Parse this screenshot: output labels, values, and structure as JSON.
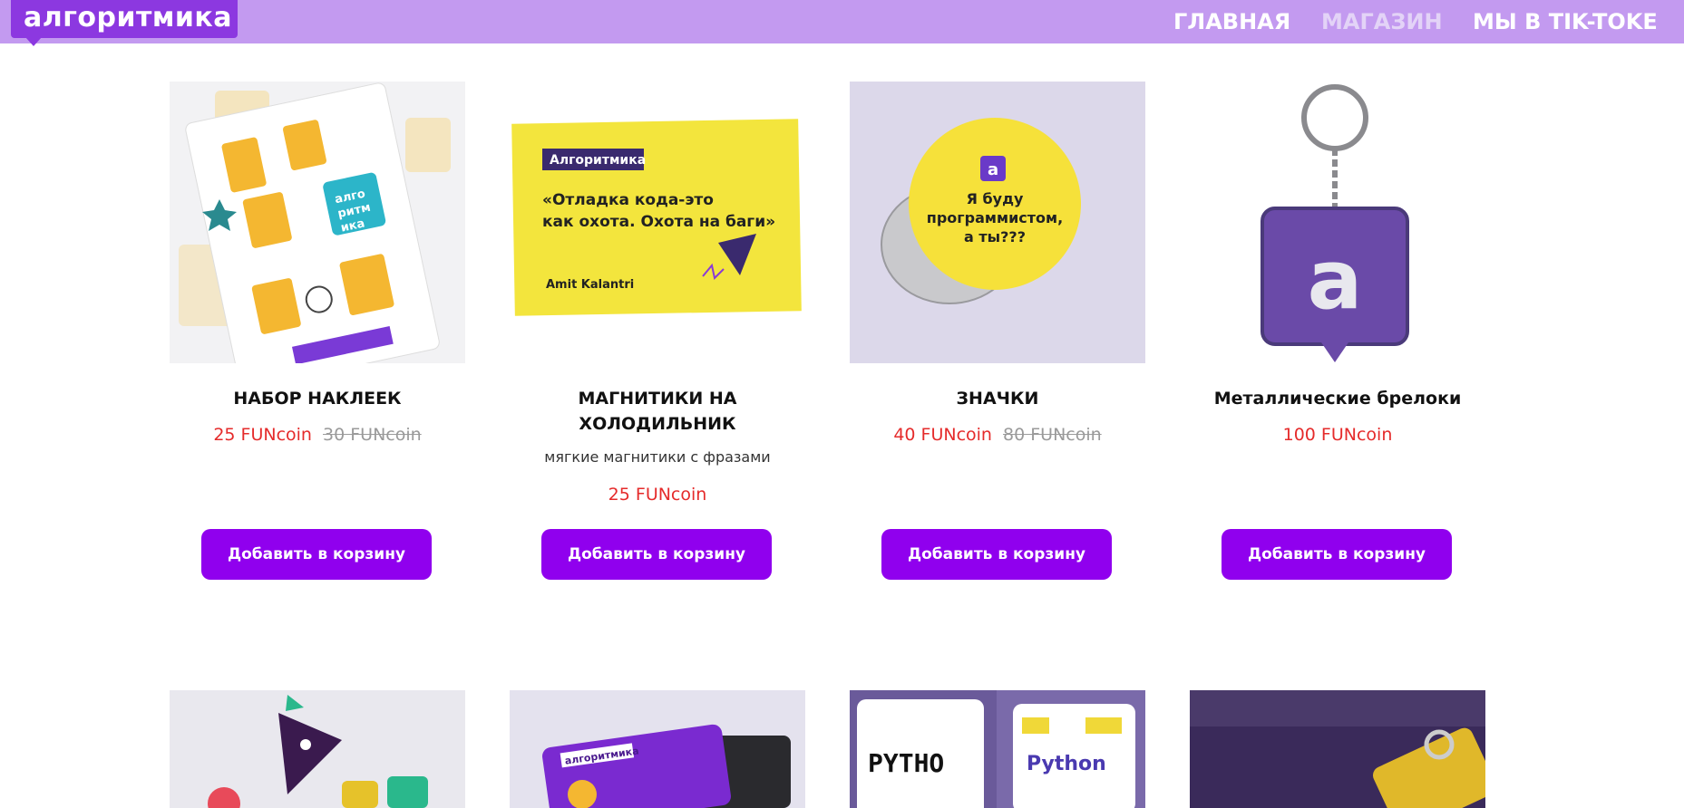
{
  "header": {
    "logo_text": "алгоритмика",
    "nav": [
      "ГЛАВНАЯ",
      "МАГАЗИН",
      "МЫ В TIK-TOKE"
    ]
  },
  "products": [
    {
      "title": "НАБОР НАКЛЕЕК",
      "price": "25 FUNcoin",
      "old_price": "30 FUNcoin",
      "button": "Добавить в корзину"
    },
    {
      "title_line1": "МАГНИТИКИ НА",
      "title_line2": "ХОЛОДИЛЬНИК",
      "description": "мягкие магнитики с фразами",
      "price": "25 FUNcoin",
      "button": "Добавить в корзину",
      "image_text": {
        "brand": "Алгоритмика",
        "quote_line1": "«Отладка кода-это",
        "quote_line2": "как охота. Охота на баги»",
        "author": "Amit Kalantri"
      }
    },
    {
      "title": "ЗНАЧКИ",
      "price": "40 FUNcoin",
      "old_price": "80 FUNcoin",
      "button": "Добавить в корзину",
      "image_text": {
        "badge_letter": "a",
        "line1": "Я буду",
        "line2": "программистом,",
        "line3": "а ты???"
      }
    },
    {
      "title": "Металлические брелоки",
      "price": "100 FUNcoin",
      "button": "Добавить в корзину",
      "image_text": {
        "letter": "a"
      }
    }
  ],
  "second_row_images": [
    {
      "alt": "sticker-characters"
    },
    {
      "alt": "purple-card",
      "text": "алгоритмика"
    },
    {
      "alt": "mugs",
      "text_left": "PYTHO",
      "text_right": "Python"
    },
    {
      "alt": "bottle"
    }
  ],
  "colors": {
    "header_bg": "#c39af0",
    "logo_bg": "#8c38e0",
    "button_bg": "#9000ee",
    "price": "#e52b2b",
    "old_price": "#9a9a9a"
  }
}
